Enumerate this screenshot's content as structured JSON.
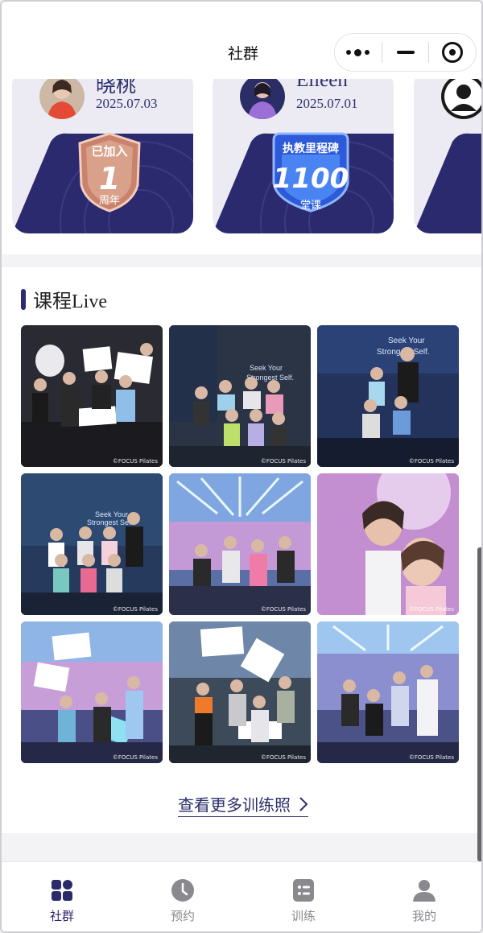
{
  "header": {
    "title": "社群"
  },
  "cards": [
    {
      "name": "晓桃",
      "date": "2025.07.03",
      "badge": {
        "top": "已加入",
        "value": "1",
        "unit": "周年",
        "color": "#d9957f"
      }
    },
    {
      "name": "Elleen",
      "date": "2025.07.01",
      "badge": {
        "top": "执教里程碑",
        "value": "1100",
        "unit": "堂课",
        "color": "#3b6ee8"
      }
    },
    {
      "name": "",
      "date": "",
      "badge": null
    }
  ],
  "live": {
    "title": "课程Live",
    "watermark": "©FOCUS Pilates",
    "photo_texts": [
      "Seek Your Strongest Self",
      "Seek Your Strongest Self.",
      "Seek Your Strongest Self."
    ],
    "more": "查看更多训练照"
  },
  "tabs": [
    {
      "label": "社群",
      "icon": "community-icon",
      "active": true
    },
    {
      "label": "预约",
      "icon": "clock-icon",
      "active": false
    },
    {
      "label": "训练",
      "icon": "training-icon",
      "active": false
    },
    {
      "label": "我的",
      "icon": "profile-icon",
      "active": false
    }
  ],
  "colors": {
    "accent": "#2b2a6a",
    "tab_inactive": "#8a8a8e"
  }
}
